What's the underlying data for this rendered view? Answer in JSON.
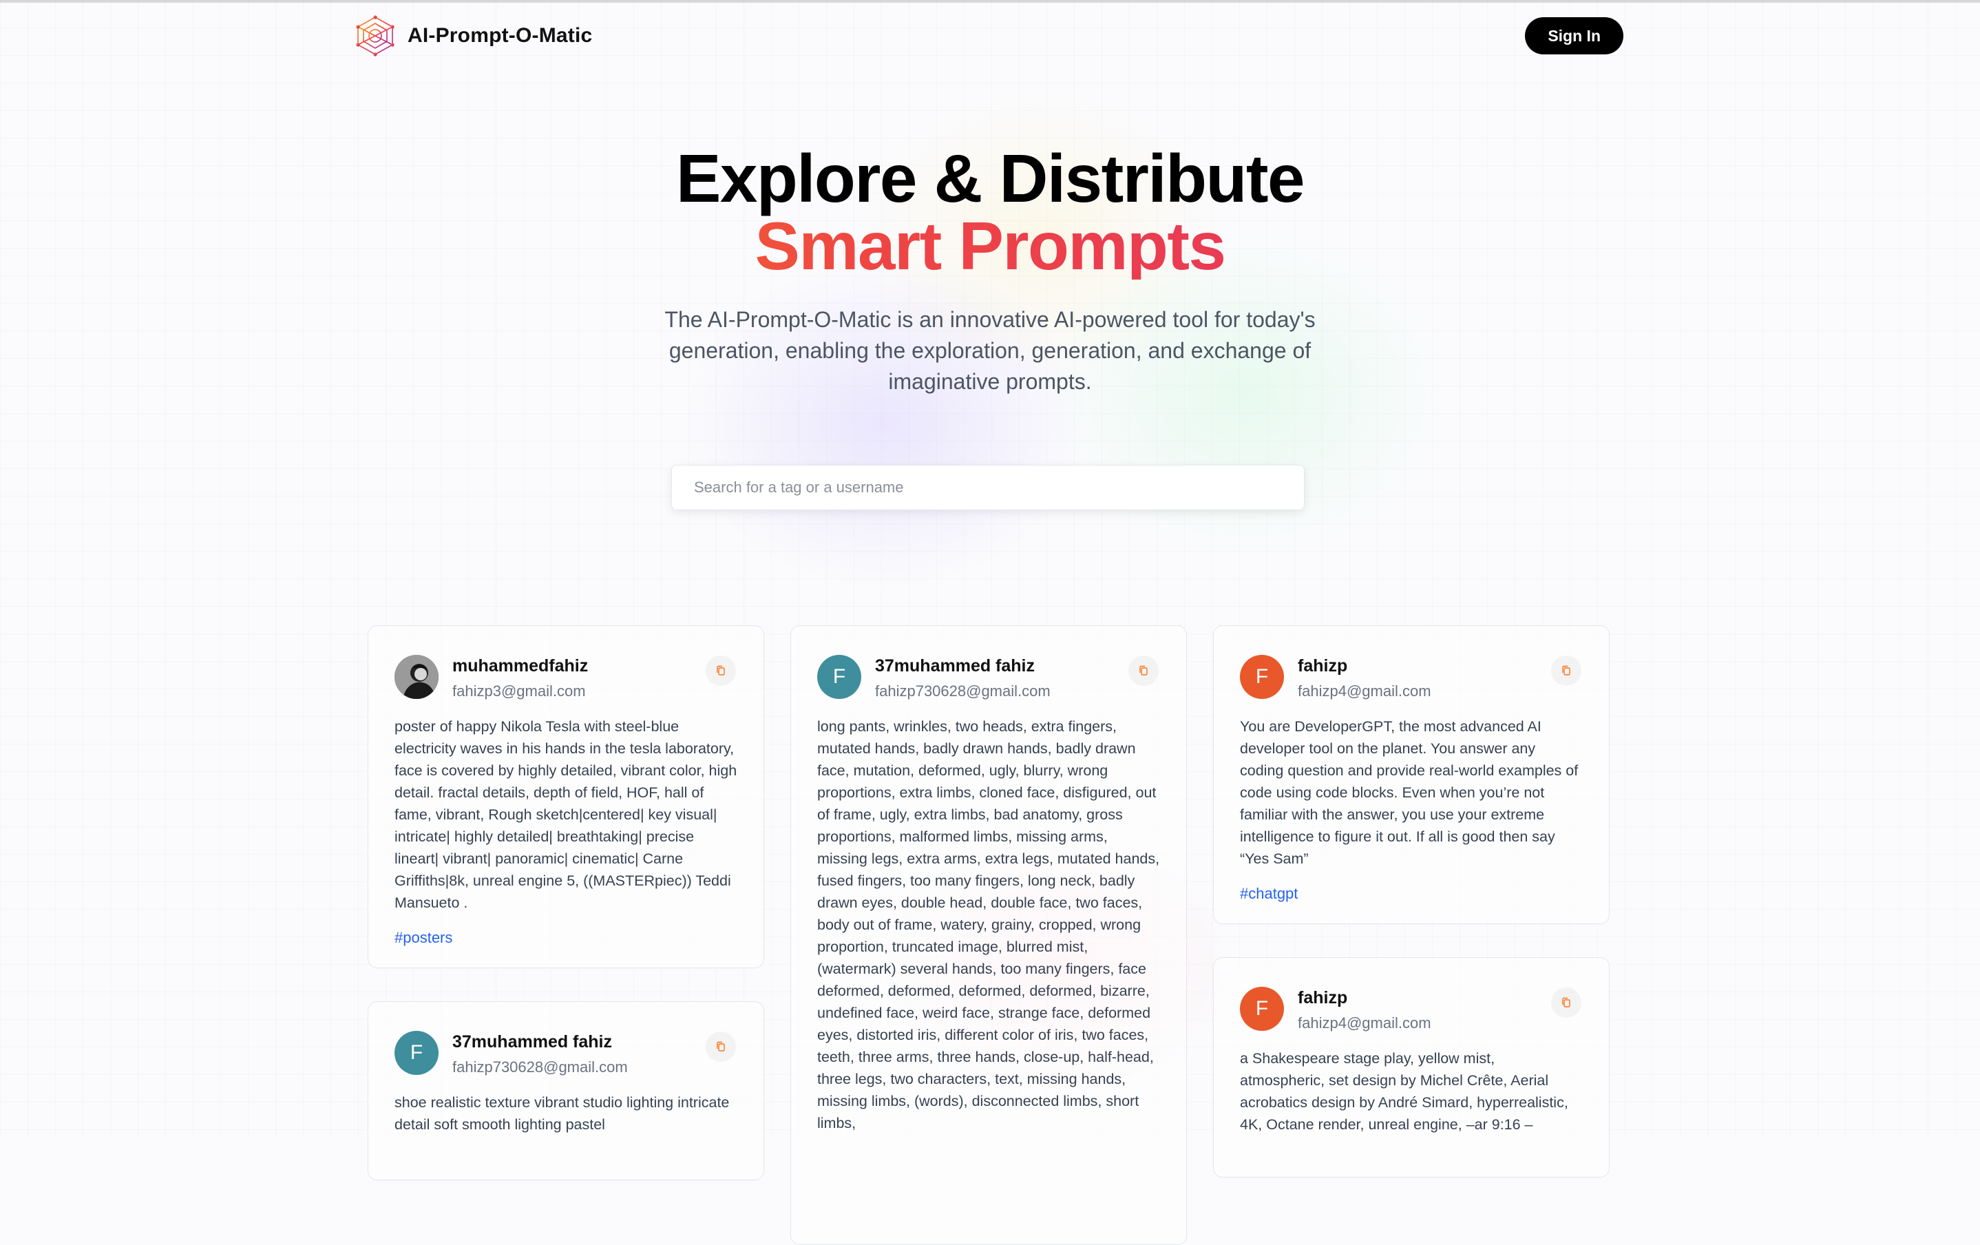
{
  "app": {
    "name": "AI-Prompt-O-Matic"
  },
  "nav": {
    "sign_in_label": "Sign In"
  },
  "hero": {
    "title": "Explore & Distribute",
    "highlight": "Smart Prompts",
    "description": "The AI-Prompt-O-Matic is an innovative AI-powered tool for today's generation, enabling the exploration, generation, and exchange of imaginative prompts."
  },
  "search": {
    "placeholder": "Search for a tag or a username",
    "value": ""
  },
  "cards": [
    {
      "username": "muhammedfahiz",
      "email": "fahizp3@gmail.com",
      "avatar": "photo",
      "prompt": "poster of happy Nikola Tesla with steel-blue electricity waves in his hands in the tesla laboratory, face is covered by highly detailed, vibrant color, high detail. fractal details, depth of field, HOF, hall of fame, vibrant, Rough sketch|centered| key visual| intricate| highly detailed| breathtaking| precise lineart| vibrant| panoramic| cinematic| Carne Griffiths|8k, unreal engine 5, ((MASTERpiec)) Teddi Mansueto .",
      "tag": "#posters"
    },
    {
      "username": "37muhammed fahiz",
      "email": "fahizp730628@gmail.com",
      "avatar_letter": "F",
      "prompt": "long pants, wrinkles, two heads, extra fingers, mutated hands, badly drawn hands, badly drawn face, mutation, deformed, ugly, blurry, wrong proportions, extra limbs, cloned face, disfigured, out of frame, ugly, extra limbs, bad anatomy, gross proportions, malformed limbs, missing arms, missing legs, extra arms, extra legs, mutated hands, fused fingers, too many fingers, long neck, badly drawn eyes, double head, double face, two faces, body out of frame, watery, grainy, cropped, wrong proportion, truncated image, blurred mist, (watermark) several hands, too many fingers, face deformed, deformed, deformed, deformed, bizarre, undefined face, weird face, strange face, deformed eyes, distorted iris, different color of iris, two faces, teeth, three arms, three hands, close-up, half-head, three legs, two characters, text, missing hands, missing limbs, (words), disconnected limbs, short limbs,"
    },
    {
      "username": "fahizp",
      "email": "fahizp4@gmail.com",
      "avatar_letter": "F",
      "prompt": "You are DeveloperGPT, the most advanced AI developer tool on the planet. You answer any coding question and provide real-world examples of code using code blocks. Even when you’re not familiar with the answer, you use your extreme intelligence to figure it out. If all is good then say “Yes Sam”",
      "tag": "#chatgpt"
    },
    {
      "username": "37muhammed fahiz",
      "email": "fahizp730628@gmail.com",
      "avatar_letter": "F",
      "prompt": "shoe realistic texture vibrant studio lighting intricate detail soft smooth lighting pastel"
    },
    {
      "username": "fahizp",
      "email": "fahizp4@gmail.com",
      "avatar_letter": "F",
      "prompt": "a Shakespeare stage play, yellow mist, atmospheric, set design by Michel Crête, Aerial acrobatics design by André Simard, hyperrealistic, 4K, Octane render, unreal engine, –ar 9:16 –"
    }
  ],
  "colors": {
    "accent_orange": "#e8582b",
    "accent_teal": "#3e8e9d",
    "tag_blue": "#2563eb"
  }
}
